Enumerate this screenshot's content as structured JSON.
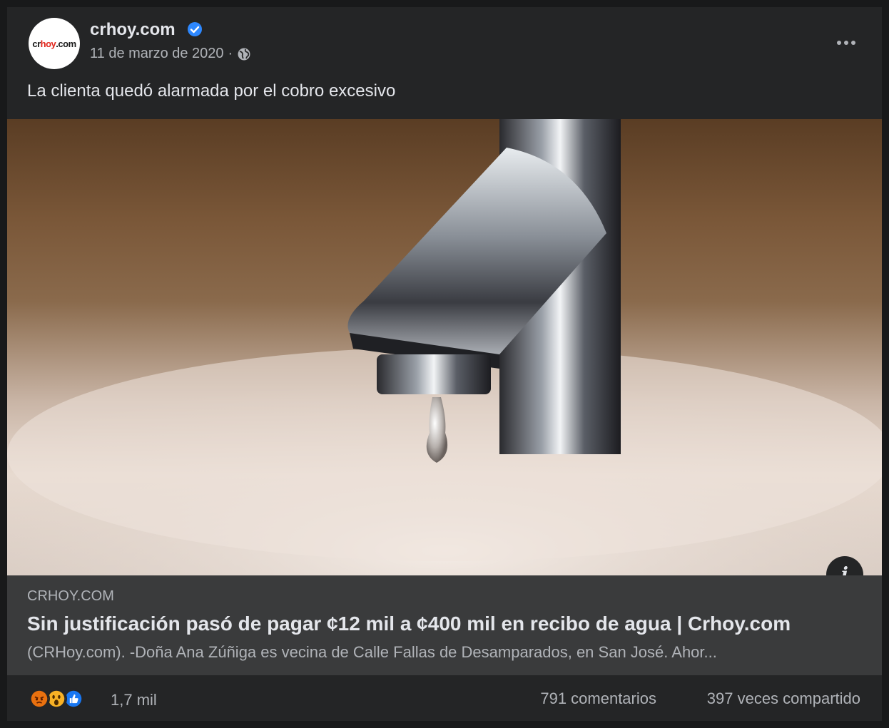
{
  "post": {
    "page_name": "crhoy.com",
    "avatar_logo_text": "crhoy.com",
    "date": "11 de marzo de 2020",
    "date_separator": "·",
    "caption": "La clienta quedó alarmada por el cobro excesivo",
    "more_icon": "more-horizontal-icon",
    "verified_icon": "verified-badge-icon",
    "privacy_icon": "globe-icon"
  },
  "link_preview": {
    "domain": "CRHOY.COM",
    "title": "Sin justificación pasó de pagar ¢12 mil a ¢400 mil en recibo de agua | Crhoy.com",
    "description": "(CRHoy.com). -Doña Ana Zúñiga es vecina de Calle Fallas de Desamparados, en San José. Ahor...",
    "info_label": "i"
  },
  "stats": {
    "reactions": [
      "angry",
      "wow",
      "like"
    ],
    "reaction_count": "1,7 mil",
    "comments": "791 comentarios",
    "shares": "397 veces compartido"
  },
  "colors": {
    "card_bg": "#242526",
    "link_bg": "#3a3b3c",
    "verified": "#2d88ff",
    "angry": "#e9710f",
    "wow": "#f7b125",
    "like": "#1877f2"
  }
}
